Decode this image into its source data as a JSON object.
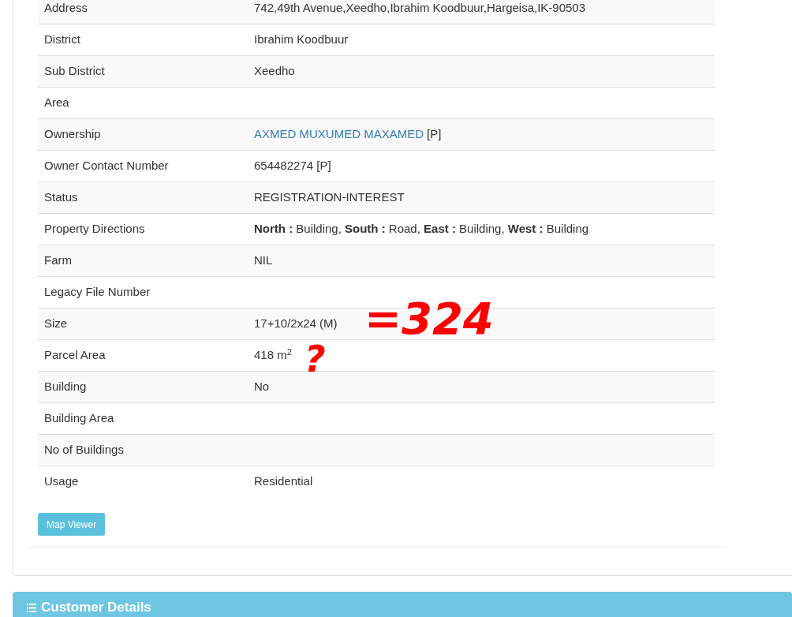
{
  "details": [
    {
      "label": "Address",
      "value": "742,49th Avenue,Xeedho,Ibrahim Koodbuur,Hargeisa,IK-90503"
    },
    {
      "label": "District",
      "value": "Ibrahim Koodbuur"
    },
    {
      "label": "Sub District",
      "value": "Xeedho"
    },
    {
      "label": "Area"
    },
    {
      "label": "Ownership",
      "link": "AXMED MUXUMED MAXAMED",
      "value": "[P]"
    },
    {
      "label": "Owner Contact Number",
      "value": "654482274 [P]"
    },
    {
      "label": "Status",
      "value": "REGISTRATION-INTEREST"
    },
    {
      "label": "Property Directions",
      "value": "**North :** Building, **South :** Road, **East :** Building, **West :** Building"
    },
    {
      "label": "Farm",
      "value": "NIL"
    },
    {
      "label": "Legacy File Number"
    },
    {
      "label": "Size",
      "value": "17+10/2x24 (M)"
    },
    {
      "label": "Parcel Area",
      "value": "418 m$^{2}$"
    },
    {
      "label": "Building",
      "value": "No"
    },
    {
      "label": "Building Area"
    },
    {
      "label": "No of Buildings"
    },
    {
      "label": "Usage",
      "value": "Residential"
    }
  ],
  "map_button": "Map Viewer",
  "customer_panel": {
    "title": "Customer Details"
  },
  "annotations": [
    "=324",
    "?"
  ]
}
